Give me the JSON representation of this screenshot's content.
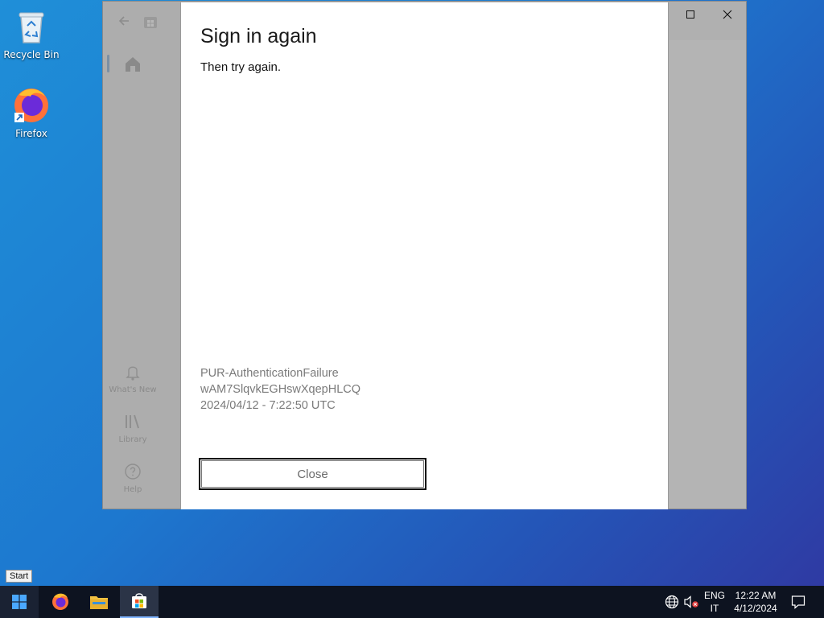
{
  "desktop": {
    "icons": [
      {
        "label": "Recycle Bin",
        "icon": "recycle-bin-icon"
      },
      {
        "label": "Firefox",
        "icon": "firefox-icon"
      }
    ]
  },
  "store_window": {
    "sidebar": {
      "items": [
        {
          "label": "What's New",
          "icon": "bell-icon"
        },
        {
          "label": "Library",
          "icon": "library-icon"
        },
        {
          "label": "Help",
          "icon": "help-icon"
        }
      ]
    }
  },
  "dialog": {
    "title": "Sign in again",
    "message": "Then try again.",
    "error_code": "PUR-AuthenticationFailure",
    "correlation_id": "wAM7SlqvkEGHswXqepHLCQ",
    "timestamp": "2024/04/12 - 7:22:50 UTC",
    "close_label": "Close"
  },
  "taskbar": {
    "start_tooltip": "Start",
    "language": "ENG",
    "keyboard": "IT",
    "time": "12:22 AM",
    "date": "4/12/2024"
  },
  "colors": {
    "desktop_gradient_start": "#1f8fd8",
    "desktop_gradient_end": "#2f3aa3",
    "taskbar": "#0d1320",
    "overlay_gray": "#b4b4b4"
  }
}
